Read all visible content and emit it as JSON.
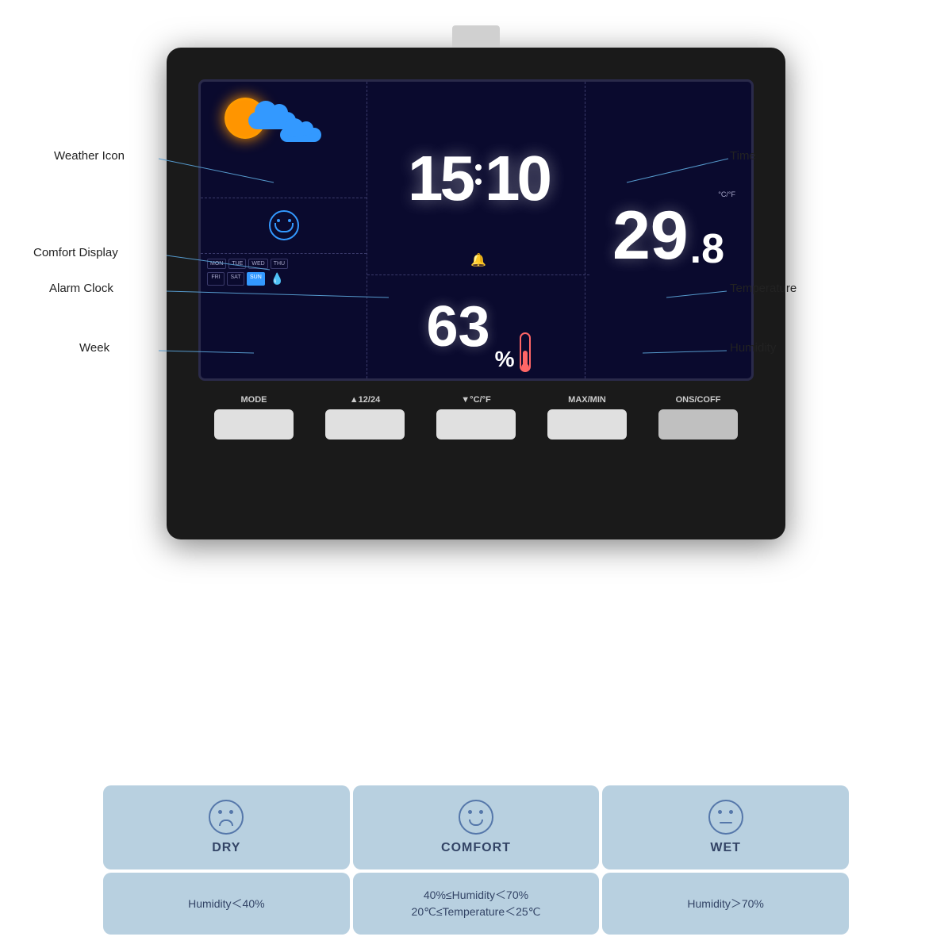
{
  "device": {
    "time_hours": "15",
    "time_minutes": "10",
    "humidity_value": "63",
    "humidity_unit": "%",
    "temperature_integer": "29",
    "temperature_decimal": ".8",
    "temperature_unit": "°C",
    "days": [
      {
        "label": "MON",
        "active": false
      },
      {
        "label": "TUE",
        "active": false
      },
      {
        "label": "WED",
        "active": false
      },
      {
        "label": "THU",
        "active": false
      },
      {
        "label": "FRI",
        "active": false
      },
      {
        "label": "SAT",
        "active": false
      },
      {
        "label": "SUN",
        "active": true
      }
    ]
  },
  "annotations": {
    "weather_icon": "Weather Icon",
    "time": "Time",
    "comfort_display": "Comfort Display",
    "alarm_clock": "Alarm Clock",
    "temperature": "Temperature",
    "week": "Week",
    "humidity": "Humidity"
  },
  "buttons": [
    {
      "id": "mode",
      "label": "MODE"
    },
    {
      "id": "time12",
      "label": "▲12/24"
    },
    {
      "id": "tempunit",
      "label": "▼°C/°F"
    },
    {
      "id": "maxmin",
      "label": "MAX/MIN"
    },
    {
      "id": "onoff",
      "label": "ONS/COFF"
    }
  ],
  "states": [
    {
      "id": "dry",
      "face": "sad",
      "label": "DRY",
      "condition": "Humidity＜40%"
    },
    {
      "id": "comfort",
      "face": "happy",
      "label": "COMFORT",
      "condition": "40%≤Humidity＜70%\n20℃≤Temperature＜25℃"
    },
    {
      "id": "wet",
      "face": "neutral",
      "label": "WET",
      "condition": "Humidity＞70%"
    }
  ]
}
